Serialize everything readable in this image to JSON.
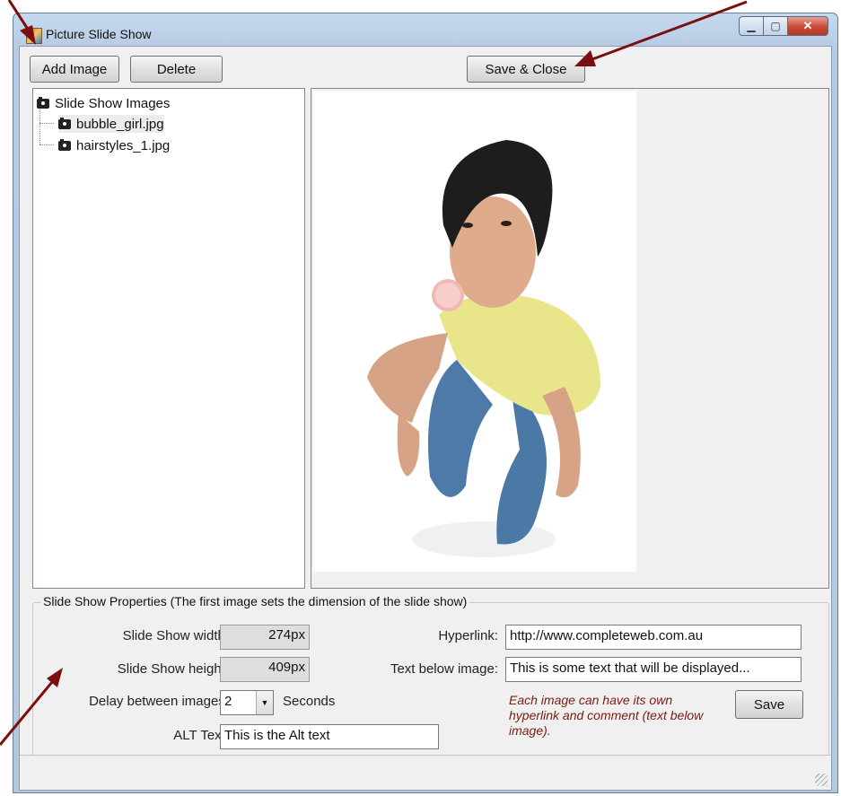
{
  "window": {
    "title": "Picture Slide Show"
  },
  "toolbar": {
    "add_image": "Add Image",
    "delete": "Delete",
    "save_close": "Save & Close"
  },
  "tree": {
    "root": "Slide Show Images",
    "items": [
      "bubble_girl.jpg",
      "hairstyles_1.jpg"
    ]
  },
  "props": {
    "legend": "Slide Show Properties (The first image sets the dimension of the slide show)",
    "width_label": "Slide Show width:",
    "width_value": "274px",
    "height_label": "Slide Show height:",
    "height_value": "409px",
    "delay_label": "Delay between images:",
    "delay_value": "2",
    "delay_unit": "Seconds",
    "alt_label": "ALT Text:",
    "alt_value": "This is the Alt text",
    "hyperlink_label": "Hyperlink:",
    "hyperlink_value": "http://www.completeweb.com.au",
    "text_below_label": "Text below image:",
    "text_below_value": "This is some text that will be displayed...",
    "note": "Each image can have its own hyperlink and comment (text below image).",
    "save": "Save"
  },
  "colors": {
    "arrow": "#7a0f0f",
    "note": "#7a1c0e",
    "titlebar": "#b9cde5"
  },
  "icons": [
    "camera-icon",
    "minimize-icon",
    "maximize-icon",
    "close-icon",
    "dropdown-arrow-icon"
  ]
}
